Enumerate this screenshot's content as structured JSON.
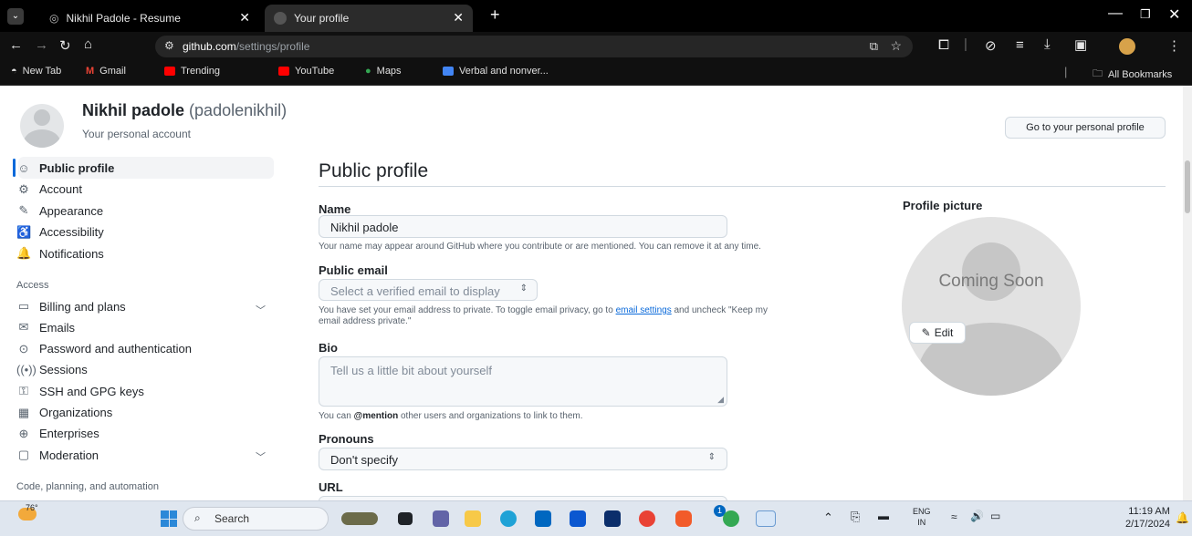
{
  "browser": {
    "tabs": [
      {
        "title": "Nikhil Padole - Resume",
        "close": "✕"
      },
      {
        "title": "Your profile",
        "close": "✕"
      }
    ],
    "new_tab": "+",
    "url_host": "github.com",
    "url_path": "/settings/profile",
    "bookmarks": [
      "New Tab",
      "Gmail",
      "Trending",
      "YouTube",
      "Maps",
      "Verbal and nonver..."
    ],
    "all_bookmarks": "All Bookmarks"
  },
  "header": {
    "display_name": "Nikhil padole",
    "username": "(padolenikhil)",
    "subtitle": "Your personal account",
    "personal_profile_button": "Go to your personal profile"
  },
  "sidebar": {
    "items_top": [
      {
        "label": "Public profile",
        "icon": "person-icon",
        "glyph": "☺"
      },
      {
        "label": "Account",
        "icon": "gear-icon",
        "glyph": "⚙"
      },
      {
        "label": "Appearance",
        "icon": "paintbrush-icon",
        "glyph": "✎"
      },
      {
        "label": "Accessibility",
        "icon": "accessibility-icon",
        "glyph": "♿"
      },
      {
        "label": "Notifications",
        "icon": "bell-icon",
        "glyph": "🔔"
      }
    ],
    "access_heading": "Access",
    "items_access": [
      {
        "label": "Billing and plans",
        "icon": "credit-card-icon",
        "glyph": "▭"
      },
      {
        "label": "Emails",
        "icon": "mail-icon",
        "glyph": "✉"
      },
      {
        "label": "Password and authentication",
        "icon": "shield-lock-icon",
        "glyph": "⊙"
      },
      {
        "label": "Sessions",
        "icon": "broadcast-icon",
        "glyph": "((•))"
      },
      {
        "label": "SSH and GPG keys",
        "icon": "key-icon",
        "glyph": "⚿"
      },
      {
        "label": "Organizations",
        "icon": "organization-icon",
        "glyph": "▦"
      },
      {
        "label": "Enterprises",
        "icon": "globe-icon",
        "glyph": "⊕"
      },
      {
        "label": "Moderation",
        "icon": "report-icon",
        "glyph": "▢"
      }
    ],
    "code_heading": "Code, planning, and automation"
  },
  "main": {
    "title": "Public profile",
    "name_label": "Name",
    "name_value": "Nikhil padole",
    "name_note": "Your name may appear around GitHub where you contribute or are mentioned. You can remove it at any time.",
    "email_label": "Public email",
    "email_select": "Select a verified email to display",
    "email_note_1": "You have set your email address to private. To toggle email privacy, go to ",
    "email_note_link": "email settings",
    "email_note_2": " and uncheck \"Keep my",
    "email_note_3": "email address private.\"",
    "bio_label": "Bio",
    "bio_placeholder": "Tell us a little bit about yourself",
    "bio_note_1": "You can ",
    "bio_note_mention": "@mention",
    "bio_note_2": " other users and organizations to link to them.",
    "pronouns_label": "Pronouns",
    "pronouns_value": "Don't specify",
    "url_label": "URL"
  },
  "profile_picture": {
    "label": "Profile picture",
    "overlay_text": "Coming Soon",
    "edit_label": "Edit"
  },
  "taskbar": {
    "weather": "76°",
    "search": "Search",
    "lang_1": "ENG",
    "lang_2": "IN",
    "time": "11:19 AM",
    "date": "2/17/2024",
    "notification_count": "1"
  }
}
